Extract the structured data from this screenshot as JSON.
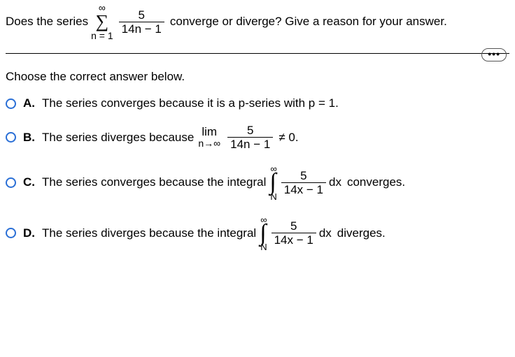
{
  "question": {
    "pre": "Does the series",
    "sigma_top": "∞",
    "sigma_sym": "∑",
    "sigma_bot": "n = 1",
    "frac_num": "5",
    "frac_den": "14n − 1",
    "post": "converge or diverge? Give a reason for your answer."
  },
  "dots": "•••",
  "instruction": "Choose the correct answer below.",
  "options": {
    "A": {
      "label": "A.",
      "text": "The series converges because it is a p-series with p = 1."
    },
    "B": {
      "label": "B.",
      "pre": "The series diverges because",
      "lim_top": "lim",
      "lim_bot": "n→∞",
      "frac_num": "5",
      "frac_den": "14n − 1",
      "post": "≠ 0."
    },
    "C": {
      "label": "C.",
      "pre": "The series converges because the integral",
      "int_top": "∞",
      "int_sym": "∫",
      "int_bot": "N",
      "frac_num": "5",
      "frac_den": "14x − 1",
      "dx": "dx",
      "post": "converges."
    },
    "D": {
      "label": "D.",
      "pre": "The series diverges because the integral",
      "int_top": "∞",
      "int_sym": "∫",
      "int_bot": "N",
      "frac_num": "5",
      "frac_den": "14x − 1",
      "dx": "dx",
      "post": "diverges."
    }
  }
}
